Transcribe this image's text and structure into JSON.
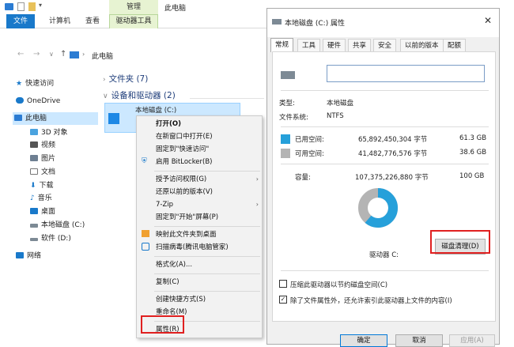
{
  "ribbon": {
    "manage": "管理",
    "title": "此电脑",
    "tabs": {
      "file": "文件",
      "computer": "计算机",
      "view": "查看",
      "drive_tools": "驱动器工具"
    }
  },
  "address": {
    "path": "此电脑"
  },
  "nav": {
    "quick": "快速访问",
    "onedrive": "OneDrive",
    "thispc": "此电脑",
    "obj3d": "3D 对象",
    "video": "视频",
    "pictures": "图片",
    "docs": "文档",
    "downloads": "下载",
    "music": "音乐",
    "desktop": "桌面",
    "localc": "本地磁盘 (C:)",
    "softd": "软件 (D:)",
    "network": "网络"
  },
  "groups": {
    "folders": "文件夹 (7)",
    "devices": "设备和驱动器 (2)"
  },
  "drive": {
    "name": "本地磁盘 (C:)"
  },
  "menu": {
    "open": "打开(O)",
    "newwin": "在新窗口中打开(E)",
    "pin_quick": "固定到\"快速访问\"",
    "bitlocker": "启用 BitLocker(B)",
    "grant": "授予访问权限(G)",
    "restore": "还原以前的版本(V)",
    "zip": "7-Zip",
    "pin_start": "固定到\"开始\"屏幕(P)",
    "map": "映射此文件夹到桌面",
    "scan": "扫描病毒(腾讯电脑管家)",
    "format": "格式化(A)...",
    "copy": "复制(C)",
    "shortcut": "创建快捷方式(S)",
    "rename": "重命名(M)",
    "props": "属性(R)"
  },
  "dialog": {
    "title": "本地磁盘 (C:) 属性",
    "tabs": {
      "general": "常规",
      "tools": "工具",
      "hardware": "硬件",
      "sharing": "共享",
      "security": "安全",
      "prev": "以前的版本",
      "quota": "配额"
    },
    "type_label": "类型:",
    "type_value": "本地磁盘",
    "fs_label": "文件系统:",
    "fs_value": "NTFS",
    "used_label": "已用空间:",
    "used_bytes": "65,892,450,304 字节",
    "used_gb": "61.3 GB",
    "free_label": "可用空间:",
    "free_bytes": "41,482,776,576 字节",
    "free_gb": "38.6 GB",
    "cap_label": "容量:",
    "cap_bytes": "107,375,226,880 字节",
    "cap_gb": "100 GB",
    "drive_label": "驱动器 C:",
    "cleanup": "磁盘清理(D)",
    "compress": "压缩此驱动器以节约磁盘空间(C)",
    "index": "除了文件属性外，还允许索引此驱动器上文件的内容(I)",
    "ok": "确定",
    "cancel": "取消",
    "apply": "应用(A)",
    "used_fraction": 0.613,
    "colors": {
      "used": "#26a0da",
      "free": "#b4b4b4"
    }
  }
}
